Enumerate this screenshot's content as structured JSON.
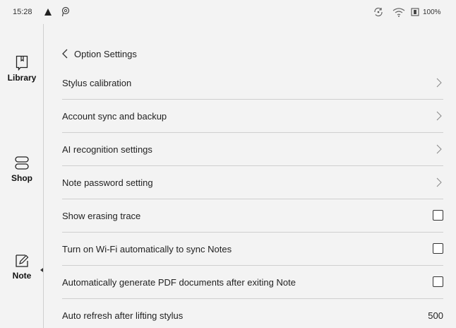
{
  "status_bar": {
    "time": "15:28",
    "battery": "100%"
  },
  "sidebar": {
    "items": [
      {
        "label": "Library",
        "icon": "book-icon"
      },
      {
        "label": "Shop",
        "icon": "shop-icon"
      },
      {
        "label": "Note",
        "icon": "note-icon",
        "active": true
      }
    ]
  },
  "header": {
    "title": "Option Settings"
  },
  "settings": [
    {
      "label": "Stylus calibration",
      "control": "chevron"
    },
    {
      "label": "Account sync and backup",
      "control": "chevron"
    },
    {
      "label": "AI recognition settings",
      "control": "chevron"
    },
    {
      "label": "Note password setting",
      "control": "chevron"
    },
    {
      "label": "Show erasing trace",
      "control": "checkbox",
      "checked": false
    },
    {
      "label": "Turn on Wi-Fi automatically to sync Notes",
      "control": "checkbox",
      "checked": false
    },
    {
      "label": "Automatically generate PDF documents after exiting Note",
      "control": "checkbox",
      "checked": false
    },
    {
      "label": "Auto refresh after lifting stylus",
      "control": "value",
      "value": "500"
    }
  ]
}
